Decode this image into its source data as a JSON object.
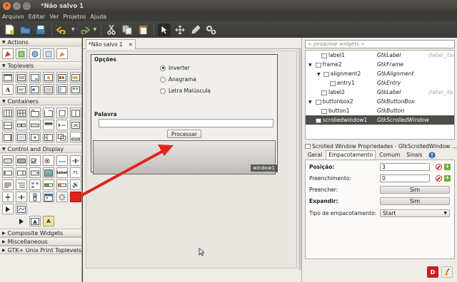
{
  "window": {
    "title": "*Não salvo 1"
  },
  "menu": [
    "Arquivo",
    "Editar",
    "Ver",
    "Projetos",
    "Ajuda"
  ],
  "palette": {
    "sections": [
      {
        "label": "Actions",
        "expanded": true
      },
      {
        "label": "Toplevels",
        "expanded": true
      },
      {
        "label": "Containers",
        "expanded": true
      },
      {
        "label": "Control and Display",
        "expanded": true
      },
      {
        "label": "Composite Widgets",
        "expanded": false
      },
      {
        "label": "Miscellaneous",
        "expanded": false
      },
      {
        "label": "GTK+ Unix Print Toplevels",
        "expanded": false
      }
    ],
    "inline_labels": {
      "label_widget": "label",
      "f1_widget": "F1"
    }
  },
  "document": {
    "tab_label": "*Não salvo 1",
    "frame_label": "Opções",
    "radios": [
      {
        "label": "Inverter",
        "checked": true
      },
      {
        "label": "Anagrama",
        "checked": false
      },
      {
        "label": "Letra Maiúscula",
        "checked": false
      }
    ],
    "word_label": "Palavra",
    "button_label": "Processar",
    "window_label": "window1"
  },
  "inspector": {
    "search_placeholder": "< pesquisar widgets >",
    "tree": [
      {
        "name": "label1",
        "type": "GtkLabel",
        "extra": "(label_iter",
        "indent": 2,
        "expander": ""
      },
      {
        "name": "frame2",
        "type": "GtkFrame",
        "extra": "",
        "indent": 1,
        "expander": "▼"
      },
      {
        "name": "alignment2",
        "type": "GtkAlignment",
        "extra": "",
        "indent": 2,
        "expander": "▼"
      },
      {
        "name": "entry1",
        "type": "GtkEntry",
        "extra": "",
        "indent": 3,
        "expander": ""
      },
      {
        "name": "label2",
        "type": "GtkLabel",
        "extra": "(label_ite",
        "indent": 2,
        "expander": ""
      },
      {
        "name": "buttonbox2",
        "type": "GtkButtonBox",
        "extra": "",
        "indent": 1,
        "expander": "▼"
      },
      {
        "name": "button1",
        "type": "GtkButton",
        "extra": "",
        "indent": 2,
        "expander": ""
      },
      {
        "name": "scrolledwindow1",
        "type": "GtkScrolledWindow",
        "extra": "",
        "indent": 1,
        "expander": "",
        "selected": true
      }
    ]
  },
  "properties": {
    "title": "Scrolled Window Propriedades - GtkScrolledWindow ...",
    "tabs": [
      "Geral",
      "Empacotamento",
      "Comum",
      "Sinais"
    ],
    "active_tab": "Empacotamento",
    "rows": {
      "posicao_label": "Posição:",
      "posicao_value": "3",
      "preenchimento_label": "Preenchimento:",
      "preenchimento_value": "0",
      "preencher_label": "Preencher:",
      "preencher_value": "Sim",
      "expandir_label": "Expandir:",
      "expandir_value": "Sim",
      "tipo_label": "Tipo de empacotamento:",
      "tipo_value": "Start"
    }
  },
  "colors": {
    "arrow": "#e0241c",
    "selection": "#4d4c48",
    "titlebar": "#3c3b37"
  }
}
